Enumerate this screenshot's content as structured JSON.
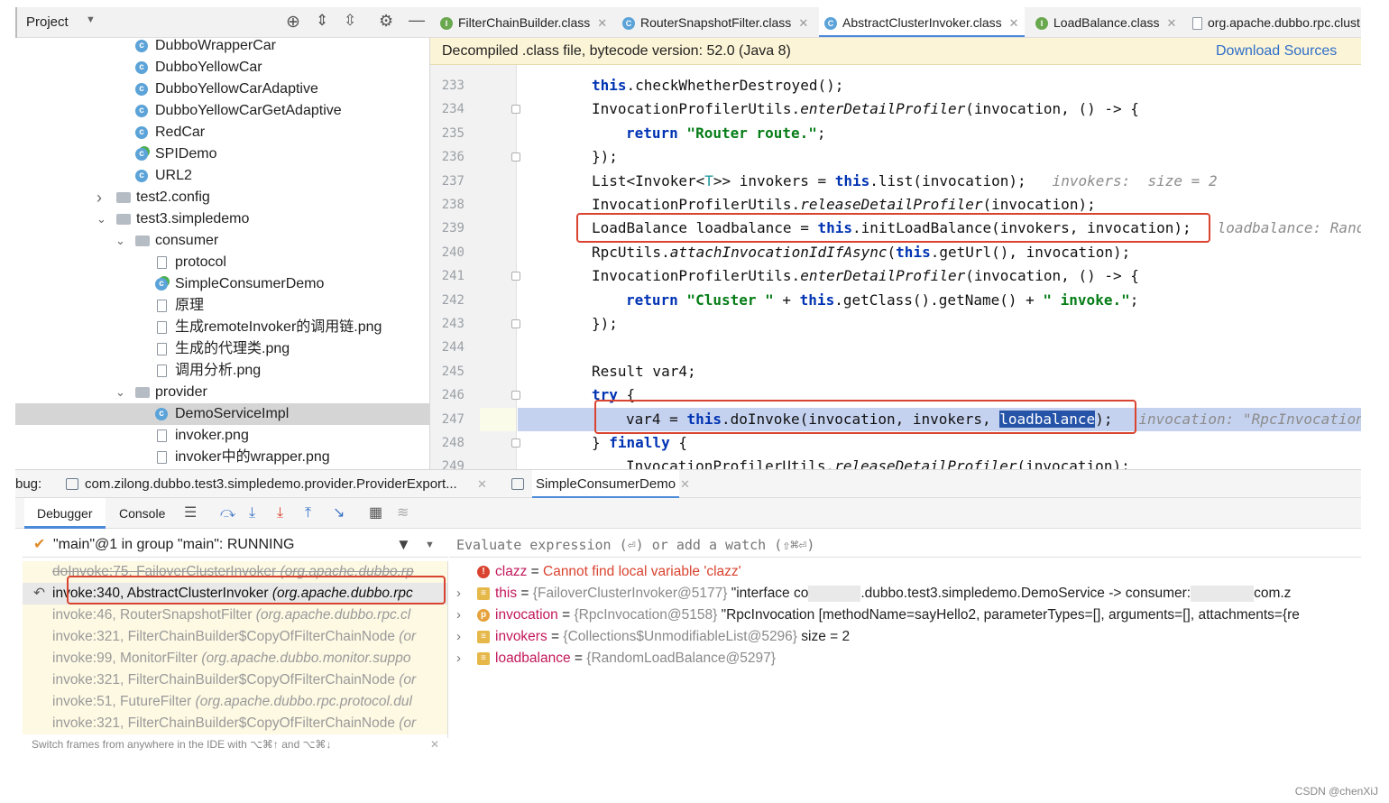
{
  "project_panel": {
    "title": "Project",
    "tree": [
      {
        "label": "DubboWrapperCar",
        "type": "class"
      },
      {
        "label": "DubboYellowCar",
        "type": "class"
      },
      {
        "label": "DubboYellowCarAdaptive",
        "type": "class"
      },
      {
        "label": "DubboYellowCarGetAdaptive",
        "type": "class"
      },
      {
        "label": "RedCar",
        "type": "class"
      },
      {
        "label": "SPIDemo",
        "type": "class-main"
      },
      {
        "label": "URL2",
        "type": "class"
      },
      {
        "label": "test2.config",
        "type": "folder-collapsed"
      },
      {
        "label": "test3.simpledemo",
        "type": "folder-expanded"
      },
      {
        "label": "consumer",
        "type": "folder-expanded"
      },
      {
        "label": "protocol",
        "type": "file"
      },
      {
        "label": "SimpleConsumerDemo",
        "type": "class-main"
      },
      {
        "label": "原理",
        "type": "file"
      },
      {
        "label": "生成remoteInvoker的调用链.png",
        "type": "file"
      },
      {
        "label": "生成的代理类.png",
        "type": "file"
      },
      {
        "label": "调用分析.png",
        "type": "file"
      },
      {
        "label": "provider",
        "type": "folder-expanded"
      },
      {
        "label": "DemoServiceImpl",
        "type": "class",
        "selected": true
      },
      {
        "label": "invoker.png",
        "type": "file"
      },
      {
        "label": "invoker中的wrapper.png",
        "type": "file"
      }
    ]
  },
  "editor_tabs": [
    {
      "label": "FilterChainBuilder.class",
      "icon": "I",
      "color": "#6aa84f"
    },
    {
      "label": "RouterSnapshotFilter.class",
      "icon": "C",
      "color": "#5ba3d8"
    },
    {
      "label": "AbstractClusterInvoker.class",
      "icon": "C",
      "color": "#5ba3d8",
      "active": true
    },
    {
      "label": "LoadBalance.class",
      "icon": "I",
      "color": "#6aa84f"
    },
    {
      "label": "org.apache.dubbo.rpc.clust",
      "icon": "file",
      "color": "#8e96a0"
    }
  ],
  "banner": {
    "text": "Decompiled .class file, bytecode version: 52.0 (Java 8)",
    "action": "Download Sources"
  },
  "code_lines": [
    {
      "n": "233"
    },
    {
      "n": "234"
    },
    {
      "n": "235"
    },
    {
      "n": "236"
    },
    {
      "n": "237"
    },
    {
      "n": "238"
    },
    {
      "n": "239"
    },
    {
      "n": "240"
    },
    {
      "n": "241"
    },
    {
      "n": "242"
    },
    {
      "n": "243"
    },
    {
      "n": "244"
    },
    {
      "n": "245"
    },
    {
      "n": "246"
    },
    {
      "n": "247"
    },
    {
      "n": "248"
    },
    {
      "n": "249"
    }
  ],
  "code": {
    "l233": [
      "this",
      ".checkWhetherDestroyed();"
    ],
    "l234": [
      "InvocationProfilerUtils.",
      "enterDetailProfiler",
      "(invocation, () -> {"
    ],
    "l235": [
      "return",
      " \"Router route.\"",
      ";"
    ],
    "l236": "});",
    "l237": [
      "List<Invoker<",
      "T",
      ">> invokers = ",
      "this",
      ".list(invocation);",
      "   invokers:  size = 2"
    ],
    "l238": [
      "InvocationProfilerUtils.",
      "releaseDetailProfiler",
      "(invocation);"
    ],
    "l239": [
      "LoadBalance loadbalance = ",
      "this",
      ".initLoadBalance(invokers, invocation);",
      "   loadbalance: RandomL"
    ],
    "l240": [
      "RpcUtils.",
      "attachInvocationIdIfAsync",
      "(",
      "this",
      ".getUrl(), invocation);"
    ],
    "l241": [
      "InvocationProfilerUtils.",
      "enterDetailProfiler",
      "(invocation, () -> {"
    ],
    "l242": [
      "return",
      " \"Cluster \"",
      " + ",
      "this",
      ".getClass().getName() + ",
      "\" invoke.\"",
      ";"
    ],
    "l243": "});",
    "l245": "Result var4;",
    "l246": [
      "try",
      " {"
    ],
    "l247": [
      "var4 = ",
      "this",
      ".doInvoke(invocation, invokers, ",
      "loadbalance",
      ");",
      "   invocation: \"RpcInvocation [m"
    ],
    "l248": [
      "} ",
      "finally",
      " {"
    ],
    "l249": [
      "InvocationProfilerUtils.",
      "releaseDetailProfiler",
      "(invocation);"
    ]
  },
  "debug": {
    "label": "bug:",
    "sessions": [
      "com.zilong.dubbo.test3.simpledemo.provider.ProviderExport...",
      "SimpleConsumerDemo"
    ],
    "tabs": [
      "Debugger",
      "Console"
    ],
    "thread": "\"main\"@1 in group \"main\": RUNNING",
    "eval_placeholder": "Evaluate expression (⏎) or add a watch (⇧⌘⏎)",
    "frames": [
      {
        "method": "doInvoke:75, FailoverClusterInvoker",
        "pkg": "(org.apache.dubbo.rp",
        "strike": true
      },
      {
        "method": "invoke:340, AbstractClusterInvoker",
        "pkg": "(org.apache.dubbo.rpc",
        "current": true
      },
      {
        "method": "invoke:46, RouterSnapshotFilter",
        "pkg": "(org.apache.dubbo.rpc.cl"
      },
      {
        "method": "invoke:321, FilterChainBuilder$CopyOfFilterChainNode",
        "pkg": "(or"
      },
      {
        "method": "invoke:99, MonitorFilter",
        "pkg": "(org.apache.dubbo.monitor.suppo"
      },
      {
        "method": "invoke:321, FilterChainBuilder$CopyOfFilterChainNode",
        "pkg": "(or"
      },
      {
        "method": "invoke:51, FutureFilter",
        "pkg": "(org.apache.dubbo.rpc.protocol.dul"
      },
      {
        "method": "invoke:321, FilterChainBuilder$CopyOfFilterChainNode",
        "pkg": "(or"
      }
    ],
    "frames_hint": "Switch frames from anywhere in the IDE with ⌥⌘↑ and ⌥⌘↓",
    "variables": [
      {
        "name": "clazz",
        "eq": " = ",
        "value": "Cannot find local variable 'clazz'",
        "kind": "error"
      },
      {
        "name": "this",
        "eq": " = ",
        "value": "{FailoverClusterInvoker@5177}",
        "extra": " \"interface co",
        "extra2": ".dubbo.test3.simpledemo.DemoService -> consumer:",
        "extra3": "com.z",
        "kind": "field"
      },
      {
        "name": "invocation",
        "eq": " = ",
        "value": "{RpcInvocation@5158}",
        "extra": " \"RpcInvocation [methodName=sayHello2, parameterTypes=[], arguments=[], attachments={re",
        "kind": "param"
      },
      {
        "name": "invokers",
        "eq": " = ",
        "value": "{Collections$UnmodifiableList@5296}",
        "extra": "  size = 2",
        "kind": "field"
      },
      {
        "name": "loadbalance",
        "eq": " = ",
        "value": "{RandomLoadBalance@5297}",
        "kind": "field"
      }
    ]
  },
  "watermark": "CSDN @chenXiJ"
}
